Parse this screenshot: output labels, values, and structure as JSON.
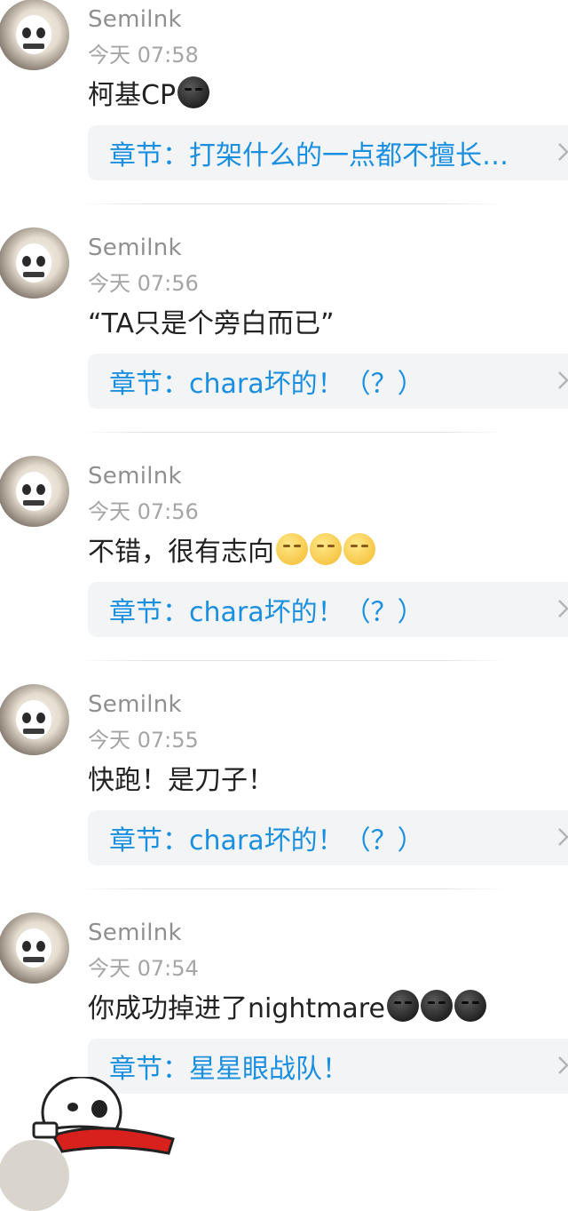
{
  "comments": [
    {
      "username": "Semilnk",
      "time": "今天 07:58",
      "text": "柯基CP",
      "emojis": [
        "dark"
      ],
      "chapter": "章节：打架什么的一点都不擅长…"
    },
    {
      "username": "Semilnk",
      "time": "今天 07:56",
      "text": "“TA只是个旁白而已”",
      "emojis": [],
      "chapter": "章节：chara坏的！（？）"
    },
    {
      "username": "Semilnk",
      "time": "今天 07:56",
      "text": "不错，很有志向",
      "emojis": [
        "smirk",
        "smirk",
        "smirk"
      ],
      "chapter": "章节：chara坏的！（？）"
    },
    {
      "username": "Semilnk",
      "time": "今天 07:55",
      "text": "快跑！是刀子！",
      "emojis": [],
      "chapter": "章节：chara坏的！（？）"
    },
    {
      "username": "Semilnk",
      "time": "今天 07:54",
      "text": "你成功掉进了nightmare",
      "emojis": [
        "dark",
        "dark",
        "dark"
      ],
      "chapter": "章节：星星眼战队！"
    }
  ],
  "icons": {
    "chevron": "chevron-right-icon",
    "emoji_dark": "dark-moon-face-icon",
    "emoji_smirk": "smirking-face-icon"
  },
  "colors": {
    "link": "#1a8fe0",
    "card_bg": "#f3f4f6",
    "username": "#8f8f8f"
  }
}
